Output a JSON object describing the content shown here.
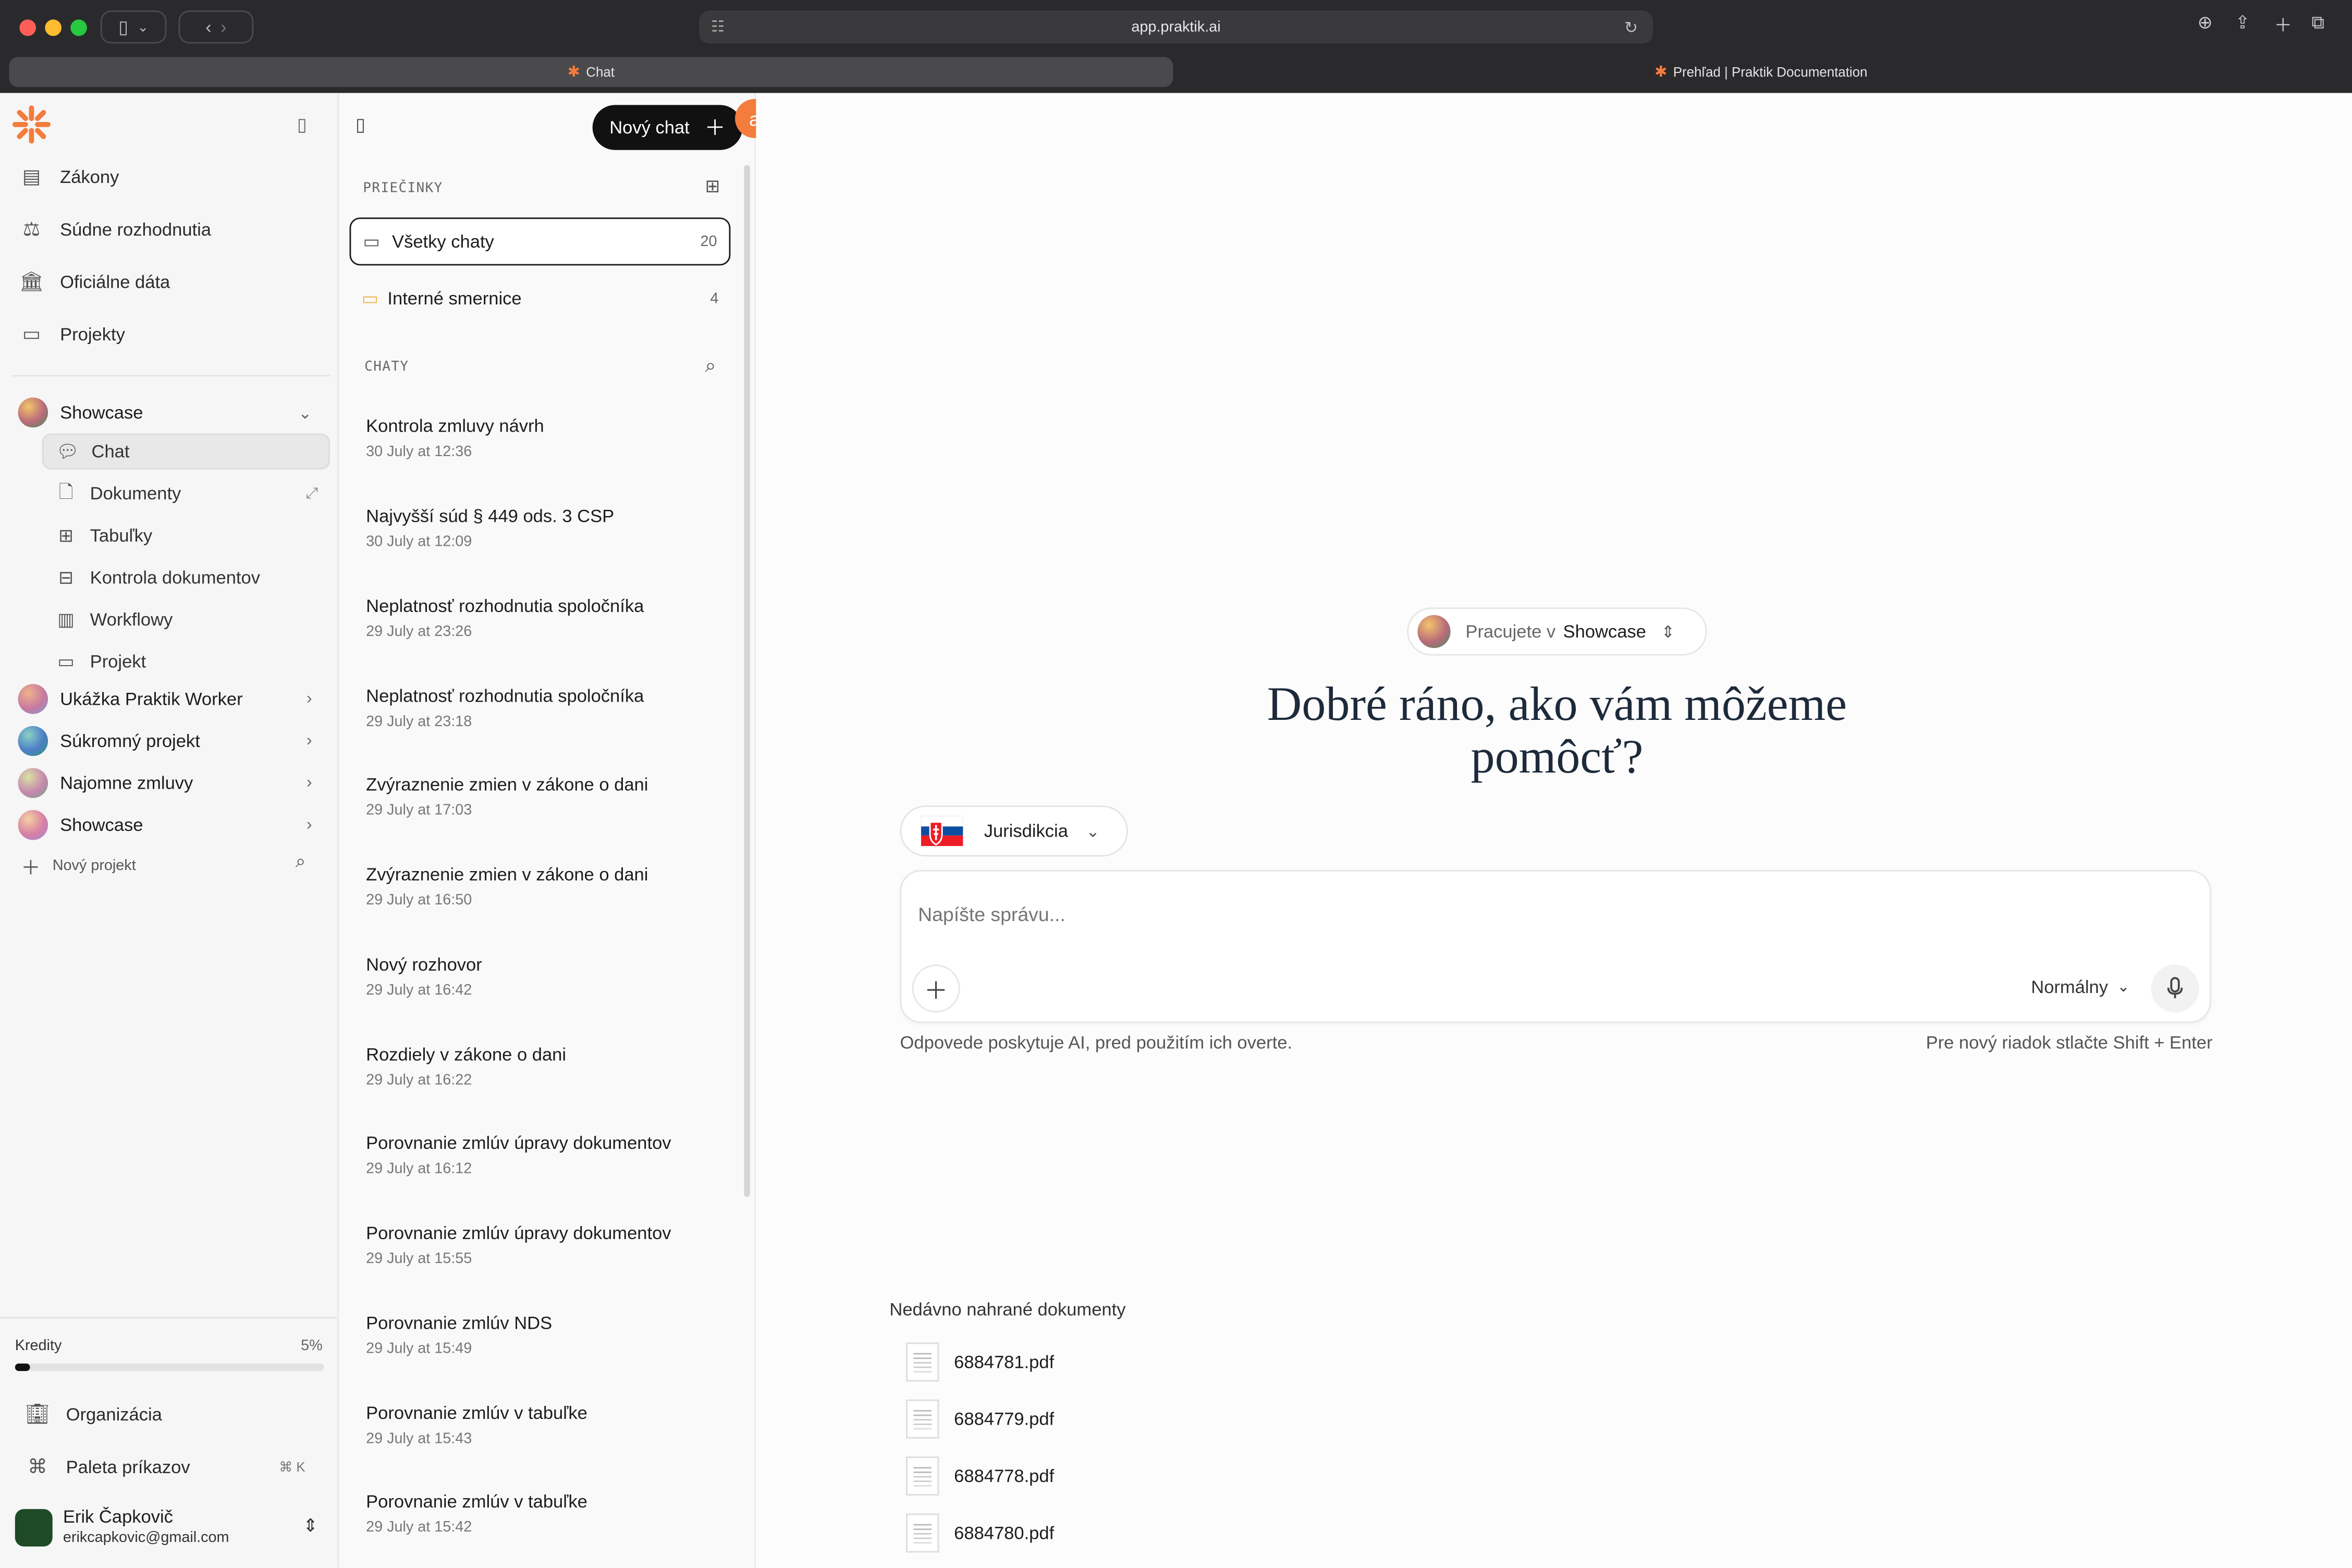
{
  "browser": {
    "url": "app.praktik.ai",
    "tabs": [
      {
        "label": "Chat",
        "active": true
      },
      {
        "label": "Prehľad | Praktik Documentation",
        "active": false
      }
    ]
  },
  "sidebar": {
    "nav": [
      {
        "label": "Zákony",
        "icon": "book-icon"
      },
      {
        "label": "Súdne rozhodnutia",
        "icon": "scales-icon"
      },
      {
        "label": "Oficiálne dáta",
        "icon": "bank-icon"
      },
      {
        "label": "Projekty",
        "icon": "folder-icon"
      }
    ],
    "active_project": {
      "name": "Showcase",
      "subitems": [
        {
          "label": "Chat",
          "active": true
        },
        {
          "label": "Dokumenty"
        },
        {
          "label": "Tabuľky"
        },
        {
          "label": "Kontrola dokumentov"
        },
        {
          "label": "Workflowy"
        },
        {
          "label": "Projekt"
        }
      ]
    },
    "projects": [
      {
        "name": "Ukážka Praktik Worker"
      },
      {
        "name": "Súkromný projekt"
      },
      {
        "name": "Najomne zmluvy"
      },
      {
        "name": "Showcase"
      }
    ],
    "new_project": "Nový projekt",
    "credits": {
      "label": "Kredity",
      "percent_label": "5%",
      "fraction": 0.05
    },
    "organization": "Organizácia",
    "command_palette": "Paleta príkazov",
    "command_shortcut": "⌘ K",
    "user": {
      "name": "Erik Čapkovič",
      "email": "erikcapkovic@gmail.com"
    }
  },
  "middle": {
    "new_chat_button": "Nový chat",
    "badge": "a",
    "folders_label": "PRIEČINKY",
    "folders": [
      {
        "label": "Všetky chaty",
        "count": "20",
        "selected": true
      },
      {
        "label": "Interné smernice",
        "count": "4"
      }
    ],
    "chats_label": "CHATY",
    "chats": [
      {
        "title": "Kontrola zmluvy návrh",
        "date": "30 July at 12:36"
      },
      {
        "title": "Najvyšší súd § 449 ods. 3 CSP",
        "date": "30 July at 12:09"
      },
      {
        "title": "Neplatnosť rozhodnutia spoločníka",
        "date": "29 July at 23:26"
      },
      {
        "title": "Neplatnosť rozhodnutia spoločníka",
        "date": "29 July at 23:18"
      },
      {
        "title": "Zvýraznenie zmien v zákone o dani",
        "date": "29 July at 17:03"
      },
      {
        "title": "Zvýraznenie zmien v zákone o dani",
        "date": "29 July at 16:50"
      },
      {
        "title": "Nový rozhovor",
        "date": "29 July at 16:42"
      },
      {
        "title": "Rozdiely v zákone o dani",
        "date": "29 July at 16:22"
      },
      {
        "title": "Porovnanie zmlúv úpravy dokumentov",
        "date": "29 July at 16:12"
      },
      {
        "title": "Porovnanie zmlúv úpravy dokumentov",
        "date": "29 July at 15:55"
      },
      {
        "title": "Porovnanie zmlúv NDS",
        "date": "29 July at 15:49"
      },
      {
        "title": "Porovnanie zmlúv v tabuľke",
        "date": "29 July at 15:43"
      },
      {
        "title": "Porovnanie zmlúv v tabuľke",
        "date": "29 July at 15:42"
      }
    ]
  },
  "main": {
    "workspace_prefix": "Pracujete v",
    "workspace_name": "Showcase",
    "greeting_line1": "Dobré ráno, ako vám môžeme",
    "greeting_line2": "pomôcť?",
    "jurisdiction": "Jurisdikcia",
    "input_placeholder": "Napíšte správu...",
    "mode": "Normálny",
    "disclaimer": "Odpovede poskytuje AI, pred použitím ich overte.",
    "hint": "Pre nový riadok stlačte Shift + Enter",
    "recent_label": "Nedávno nahrané dokumenty",
    "recent_docs": [
      "6884781.pdf",
      "6884779.pdf",
      "6884778.pdf",
      "6884780.pdf"
    ]
  },
  "colors": {
    "accent_orange": "#f47c3c",
    "dark_button": "#111111",
    "chrome_bg": "#2a2a2c"
  }
}
